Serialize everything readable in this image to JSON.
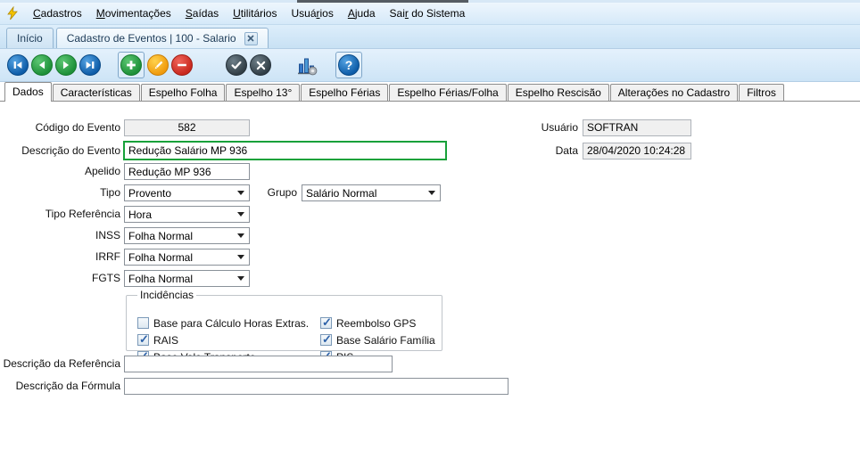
{
  "chrome": {
    "menu_items": [
      {
        "pre": "",
        "u": "C",
        "post": "adastros"
      },
      {
        "pre": "",
        "u": "M",
        "post": "ovimentações"
      },
      {
        "pre": "",
        "u": "S",
        "post": "aídas"
      },
      {
        "pre": "",
        "u": "U",
        "post": "tilitários"
      },
      {
        "pre": "Usuá",
        "u": "r",
        "post": "ios"
      },
      {
        "pre": "",
        "u": "A",
        "post": "juda"
      },
      {
        "pre": "Sai",
        "u": "r",
        "post": " do Sistema"
      }
    ],
    "doc_tabs": [
      {
        "label": "Início"
      },
      {
        "label": "Cadastro de Eventos | 100 - Salario"
      }
    ]
  },
  "toolbar": {
    "icons": [
      "nav-first",
      "nav-previous",
      "nav-next",
      "nav-last",
      "add",
      "edit",
      "delete",
      "confirm",
      "cancel",
      "chart",
      "help"
    ],
    "help_glyph": "?"
  },
  "page_tabs": [
    "Dados",
    "Características",
    "Espelho Folha",
    "Espelho 13°",
    "Espelho Férias",
    "Espelho Férias/Folha",
    "Espelho Rescisão",
    "Alterações no Cadastro",
    "Filtros"
  ],
  "form": {
    "codigo": {
      "label": "Código do Evento",
      "value": "582"
    },
    "usuario": {
      "label": "Usuário",
      "value": "SOFTRAN"
    },
    "descricao": {
      "label": "Descrição do Evento",
      "value": "Redução Salário MP 936"
    },
    "data": {
      "label": "Data",
      "value": "28/04/2020 10:24:28"
    },
    "apelido": {
      "label": "Apelido",
      "value": "Redução MP 936"
    },
    "tipo": {
      "label": "Tipo",
      "value": "Provento"
    },
    "grupo": {
      "label": "Grupo",
      "value": "Salário Normal"
    },
    "tipo_referencia": {
      "label": "Tipo Referência",
      "value": "Hora"
    },
    "inss": {
      "label": "INSS",
      "value": "Folha Normal"
    },
    "irrf": {
      "label": "IRRF",
      "value": "Folha Normal"
    },
    "fgts": {
      "label": "FGTS",
      "value": "Folha Normal"
    },
    "incidencias": {
      "legend": "Incidências",
      "col1": [
        {
          "label": "Base para Cálculo Horas Extras.",
          "checked": false
        },
        {
          "label": "RAIS",
          "checked": true
        },
        {
          "label": "Base Vale Transporte",
          "checked": true
        }
      ],
      "col2": [
        {
          "label": "Reembolso GPS",
          "checked": true
        },
        {
          "label": "Base Salário Família",
          "checked": true
        },
        {
          "label": "PIS",
          "checked": true
        }
      ]
    },
    "descricao_referencia": {
      "label": "Descrição da Referência",
      "value": ""
    },
    "descricao_formula": {
      "label": "Descrição da Fórmula",
      "value": ""
    }
  },
  "colors": {
    "focus_border": "#18a13a",
    "toolbar_blue": "#0d5ca8",
    "toolbar_green": "#1d9038",
    "toolbar_amber": "#f09a0c",
    "toolbar_red": "#c8281e",
    "toolbar_dark": "#313e46"
  }
}
